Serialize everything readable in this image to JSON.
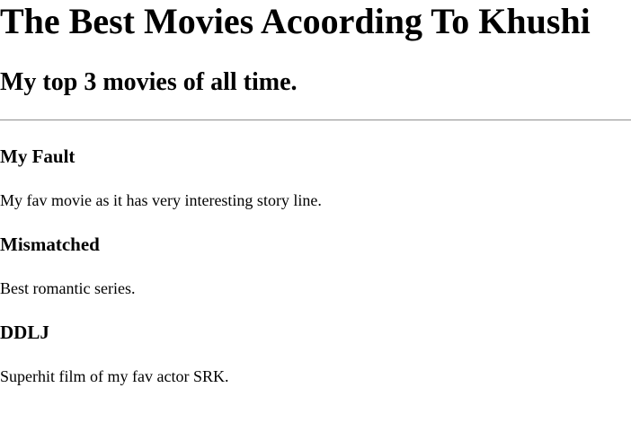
{
  "page": {
    "title": "The Best Movies Acoording To Khushi",
    "subtitle": "My top 3 movies of all time."
  },
  "movies": [
    {
      "title": "My Fault",
      "description": "My fav movie as it has very interesting story line."
    },
    {
      "title": "Mismatched",
      "description": "Best romantic series."
    },
    {
      "title": "DDLJ",
      "description": "Superhit film of my fav actor SRK."
    }
  ]
}
